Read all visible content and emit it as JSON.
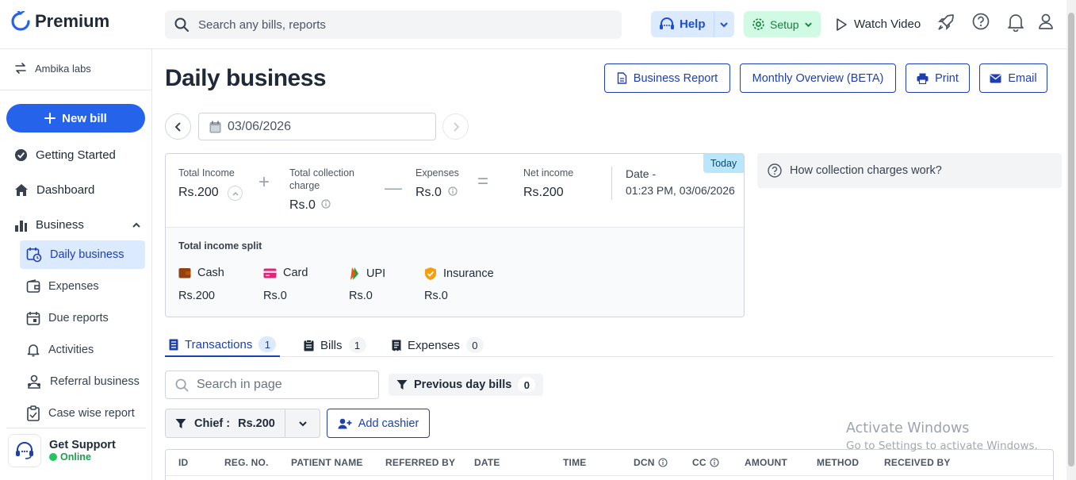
{
  "app": {
    "name": "Premium",
    "accent": "#2563eb"
  },
  "search": {
    "placeholder": "Search any bills, reports"
  },
  "topbar": {
    "help": "Help",
    "setup": "Setup",
    "watch_video": "Watch Video"
  },
  "sidebar": {
    "org": "Ambika labs",
    "new_bill": "New bill",
    "nav": [
      {
        "label": "Getting Started",
        "icon": "check-circle-icon"
      },
      {
        "label": "Dashboard",
        "icon": "home-icon"
      },
      {
        "label": "Business",
        "icon": "bar-chart-icon"
      }
    ],
    "sub": [
      {
        "label": "Daily business",
        "icon": "calendar-clock-icon",
        "active": true
      },
      {
        "label": "Expenses",
        "icon": "wallet-icon"
      },
      {
        "label": "Due reports",
        "icon": "calendar-icon"
      },
      {
        "label": "Activities",
        "icon": "bell-icon"
      },
      {
        "label": "Referral business",
        "icon": "users-icon"
      },
      {
        "label": "Case wise report",
        "icon": "clipboard-icon"
      }
    ],
    "support": {
      "title": "Get Support",
      "status": "Online"
    }
  },
  "page": {
    "title": "Daily business",
    "buttons": {
      "business_report": "Business Report",
      "monthly_overview": "Monthly Overview (BETA)",
      "print": "Print",
      "email": "Email"
    },
    "date": "03/06/2026"
  },
  "summary": {
    "total_income_label": "Total Income",
    "total_income": "Rs.200",
    "collection_label": "Total collection charge",
    "collection": "Rs.0",
    "expenses_label": "Expenses",
    "expenses": "Rs.0",
    "net_income_label": "Net income",
    "net_income": "Rs.200",
    "date_label": "Date -",
    "date_value": "01:23 PM, 03/06/2026",
    "today_badge": "Today",
    "split_title": "Total income split",
    "split": [
      {
        "label": "Cash",
        "value": "Rs.200",
        "icon": "wallet-icon"
      },
      {
        "label": "Card",
        "value": "Rs.0",
        "icon": "card-icon"
      },
      {
        "label": "UPI",
        "value": "Rs.0",
        "icon": "upi-icon"
      },
      {
        "label": "Insurance",
        "value": "Rs.0",
        "icon": "shield-icon"
      }
    ]
  },
  "help_link": "How collection charges work?",
  "tabs": [
    {
      "label": "Transactions",
      "count": "1"
    },
    {
      "label": "Bills",
      "count": "1"
    },
    {
      "label": "Expenses",
      "count": "0"
    }
  ],
  "filters": {
    "search_placeholder": "Search in page",
    "previous_day_bills": "Previous day bills",
    "previous_day_count": "0",
    "chief_label": "Chief :",
    "chief_value": "Rs.200",
    "add_cashier": "Add cashier"
  },
  "table": {
    "columns": [
      "ID",
      "REG. NO.",
      "PATIENT NAME",
      "REFERRED BY",
      "DATE",
      "TIME",
      "DCN",
      "CC",
      "AMOUNT",
      "METHOD",
      "RECEIVED BY"
    ]
  },
  "watermark": {
    "line1": "Activate Windows",
    "line2": "Go to Settings to activate Windows."
  }
}
